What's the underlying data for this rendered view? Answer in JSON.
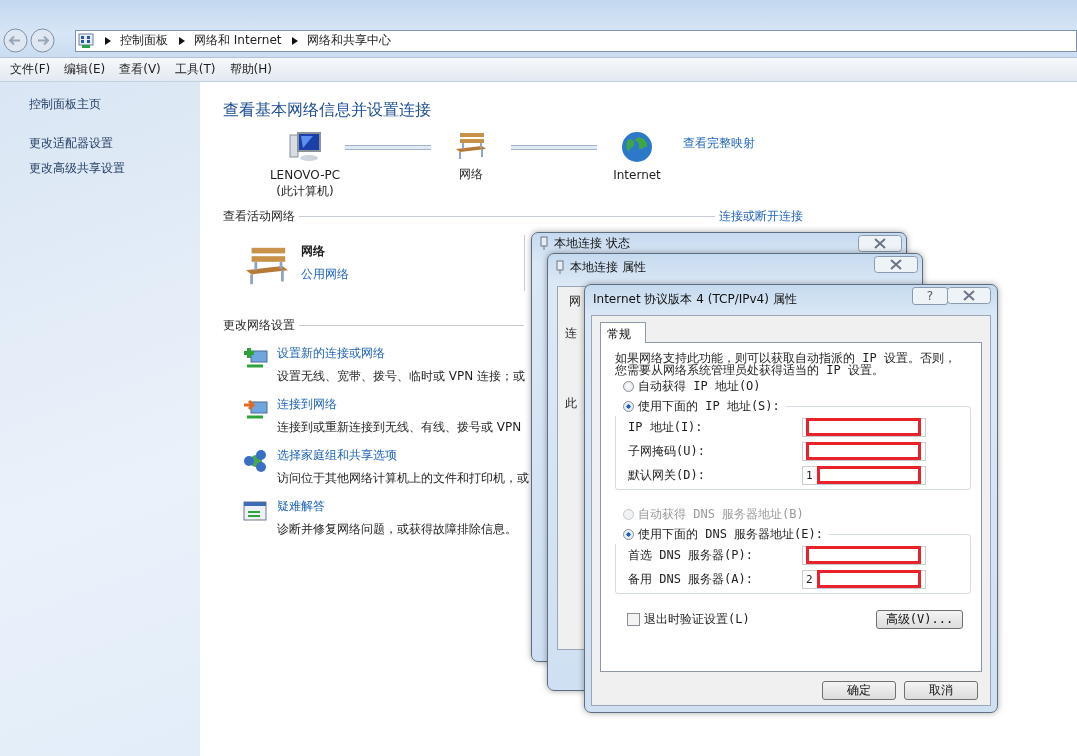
{
  "address_bar": {
    "segments": [
      "控制面板",
      "网络和 Internet",
      "网络和共享中心"
    ]
  },
  "menu": [
    "文件(F)",
    "编辑(E)",
    "查看(V)",
    "工具(T)",
    "帮助(H)"
  ],
  "sidebar": {
    "items": [
      {
        "label": "控制面板主页"
      },
      {
        "label": "更改适配器设置"
      },
      {
        "label": "更改高级共享设置"
      }
    ]
  },
  "main": {
    "title": "查看基本网络信息并设置连接",
    "map_link": "查看完整映射",
    "map_nodes": [
      {
        "kind": "computer",
        "label": "LENOVO-PC",
        "sublabel": "(此计算机)"
      },
      {
        "kind": "bench",
        "label": "网络"
      },
      {
        "kind": "globe",
        "label": "Internet"
      }
    ],
    "active_section": {
      "heading": "查看活动网络",
      "link": "连接或断开连接",
      "network": {
        "name": "网络",
        "type": "公用网络"
      }
    },
    "settings_section": {
      "heading": "更改网络设置",
      "tasks": [
        {
          "kind": "new",
          "title": "设置新的连接或网络",
          "desc": "设置无线、宽带、拨号、临时或 VPN 连接；或"
        },
        {
          "kind": "connect",
          "title": "连接到网络",
          "desc": "连接到或重新连接到无线、有线、拨号或 VPN"
        },
        {
          "kind": "homegroup",
          "title": "选择家庭组和共享选项",
          "desc": "访问位于其他网络计算机上的文件和打印机，或"
        },
        {
          "kind": "troubleshoot",
          "title": "疑难解答",
          "desc": "诊断并修复网络问题，或获得故障排除信息。"
        }
      ]
    }
  },
  "dialogs": {
    "status": {
      "title": "本地连接 状态"
    },
    "properties": {
      "title": "本地连接 属性",
      "fragments": [
        "网",
        "连",
        "此"
      ]
    },
    "ipv4": {
      "title": "Internet 协议版本 4 (TCP/IPv4) 属性",
      "help": "?",
      "tabs": [
        {
          "label": "常规",
          "selected": true
        }
      ],
      "intro": [
        "如果网络支持此功能，则可以获取自动指派的 IP 设置。否则，",
        "您需要从网络系统管理员处获得适当的 IP 设置。"
      ],
      "ip_modes": [
        {
          "label": "自动获得 IP 地址(O)",
          "selected": false,
          "disabled": false
        },
        {
          "label": "使用下面的 IP 地址(S):",
          "selected": true,
          "disabled": false
        }
      ],
      "ip_fields": [
        {
          "label": "IP 地址(I):",
          "redacted": true
        },
        {
          "label": "子网掩码(U):",
          "redacted": true
        },
        {
          "label": "默认网关(D):",
          "value": "1",
          "redacted": true
        }
      ],
      "dns_modes": [
        {
          "label": "自动获得 DNS 服务器地址(B)",
          "selected": false,
          "disabled": true
        },
        {
          "label": "使用下面的 DNS 服务器地址(E):",
          "selected": true,
          "disabled": false
        }
      ],
      "dns_fields": [
        {
          "label": "首选 DNS 服务器(P):",
          "redacted": true
        },
        {
          "label": "备用 DNS 服务器(A):",
          "value": "2",
          "redacted": true
        }
      ],
      "validate": {
        "label": "退出时验证设置(L)",
        "checked": false
      },
      "advanced": "高级(V)...",
      "buttons": [
        "确定",
        "取消"
      ]
    }
  }
}
